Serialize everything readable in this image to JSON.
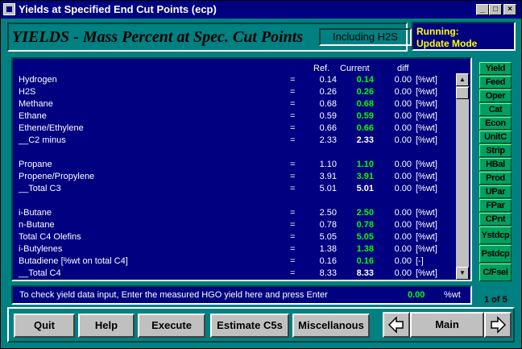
{
  "window": {
    "title": "Yields at Specified End Cut Points (ecp)",
    "controls": [
      "_",
      "□",
      "×"
    ]
  },
  "header": {
    "title": "YIELDS - Mass Percent at Spec. Cut Points",
    "badge": "Including H2S"
  },
  "status": {
    "line1": "Running:",
    "line2": "Update Mode"
  },
  "table": {
    "columns": {
      "ref": "Ref.",
      "current": "Current",
      "diff": "diff"
    },
    "rows": [
      {
        "label": "Hydrogen",
        "eq": "=",
        "ref": "0.14",
        "current": "0.14",
        "diff": "0.00",
        "unit": "[%wt]",
        "hl": true
      },
      {
        "label": "H2S",
        "eq": "=",
        "ref": "0.26",
        "current": "0.26",
        "diff": "0.00",
        "unit": "[%wt]",
        "hl": true
      },
      {
        "label": "Methane",
        "eq": "=",
        "ref": "0.68",
        "current": "0.68",
        "diff": "0.00",
        "unit": "[%wt]",
        "hl": true
      },
      {
        "label": "Ethane",
        "eq": "=",
        "ref": "0.59",
        "current": "0.59",
        "diff": "0.00",
        "unit": "[%wt]",
        "hl": true
      },
      {
        "label": "Ethene/Ethylene",
        "eq": "=",
        "ref": "0.66",
        "current": "0.66",
        "diff": "0.00",
        "unit": "[%wt]",
        "hl": true
      },
      {
        "label": "__C2 minus",
        "eq": "=",
        "ref": "2.33",
        "current": "2.33",
        "diff": "0.00",
        "unit": "[%wt]",
        "hl": false
      },
      {
        "label": "Propane",
        "eq": "=",
        "ref": "1.10",
        "current": "1.10",
        "diff": "0.00",
        "unit": "[%wt]",
        "hl": true
      },
      {
        "label": "Propene/Propylene",
        "eq": "=",
        "ref": "3.91",
        "current": "3.91",
        "diff": "0.00",
        "unit": "[%wt]",
        "hl": true
      },
      {
        "label": "__Total C3",
        "eq": "=",
        "ref": "5.01",
        "current": "5.01",
        "diff": "0.00",
        "unit": "[%wt]",
        "hl": false
      },
      {
        "label": "i-Butane",
        "eq": "=",
        "ref": "2.50",
        "current": "2.50",
        "diff": "0.00",
        "unit": "[%wt]",
        "hl": true
      },
      {
        "label": "n-Butane",
        "eq": "=",
        "ref": "0.78",
        "current": "0.78",
        "diff": "0.00",
        "unit": "[%wt]",
        "hl": true
      },
      {
        "label": "Total C4 Olefins",
        "eq": "=",
        "ref": "5.05",
        "current": "5.05",
        "diff": "0.00",
        "unit": "[%wt]",
        "hl": true
      },
      {
        "label": "i-Butylenes",
        "eq": "=",
        "ref": "1.38",
        "current": "1.38",
        "diff": "0.00",
        "unit": "[%wt]",
        "hl": true
      },
      {
        "label": "Butadiene [%wt on total C4]",
        "eq": "=",
        "ref": "0.16",
        "current": "0.16",
        "diff": "0.00",
        "unit": "[-]",
        "hl": true
      },
      {
        "label": "__Total C4",
        "eq": "=",
        "ref": "8.33",
        "current": "8.33",
        "diff": "0.00",
        "unit": "[%wt]",
        "hl": false
      }
    ]
  },
  "prompt": {
    "text": "To check yield data input, Enter the measured HGO yield here and press Enter",
    "value": "0.00",
    "unit": "%wt"
  },
  "sidebar": {
    "items": [
      "Yield",
      "Feed",
      "Oper",
      "Cat",
      "Econ",
      "UnitC",
      "Strip",
      "HBal",
      "Prod",
      "UPar",
      "FPar",
      "CPnt",
      "Ystdcp",
      "Pstdcp",
      "C/Fsel"
    ],
    "page": "1 of 5"
  },
  "toolbar": {
    "quit": "Quit",
    "help": "Help",
    "execute": "Execute",
    "estimate": "Estimate C5s",
    "misc": "Miscellanous",
    "main": "Main"
  }
}
